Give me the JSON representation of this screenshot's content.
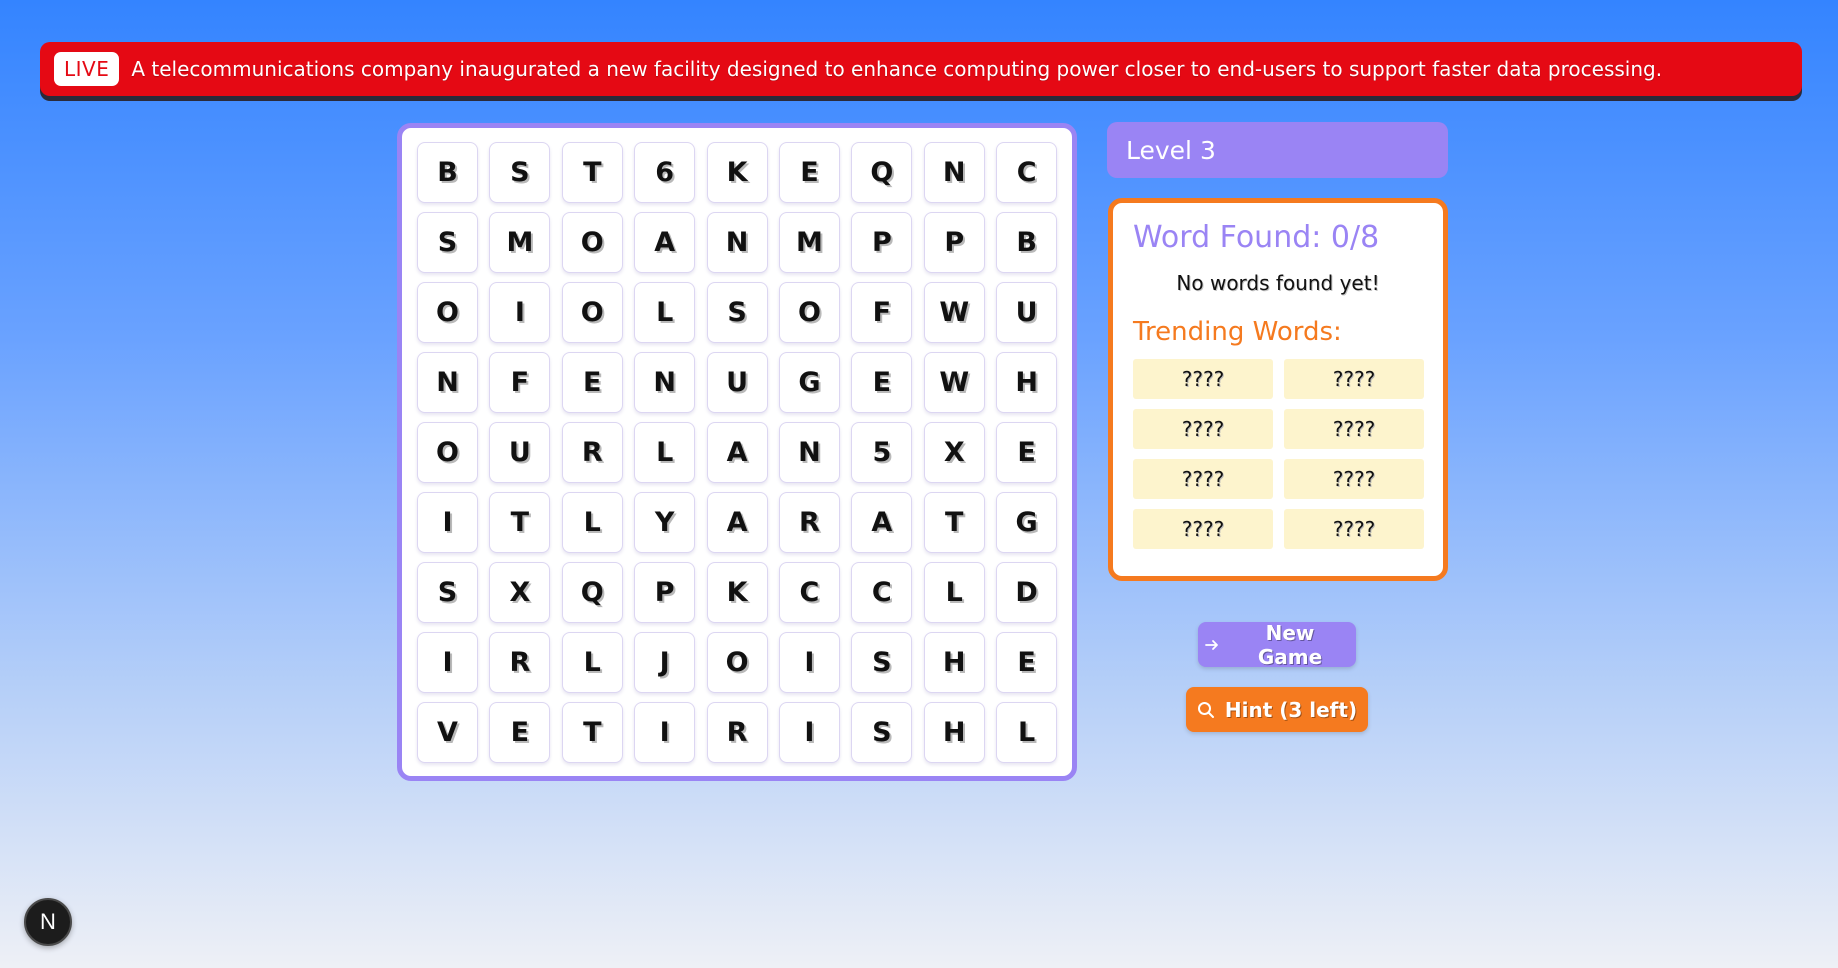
{
  "ticker": {
    "badge": "LIVE",
    "text": "A telecommunications company inaugurated a new facility designed to enhance computing power closer to end-users to support faster data processing."
  },
  "grid": {
    "rows": [
      [
        "B",
        "S",
        "T",
        "6",
        "K",
        "E",
        "Q",
        "N",
        "C"
      ],
      [
        "S",
        "M",
        "O",
        "A",
        "N",
        "M",
        "P",
        "P",
        "B"
      ],
      [
        "O",
        "I",
        "O",
        "L",
        "S",
        "O",
        "F",
        "W",
        "U"
      ],
      [
        "N",
        "F",
        "E",
        "N",
        "U",
        "G",
        "E",
        "W",
        "H"
      ],
      [
        "O",
        "U",
        "R",
        "L",
        "A",
        "N",
        "5",
        "X",
        "E"
      ],
      [
        "I",
        "T",
        "L",
        "Y",
        "A",
        "R",
        "A",
        "T",
        "G"
      ],
      [
        "S",
        "X",
        "Q",
        "P",
        "K",
        "C",
        "C",
        "L",
        "D"
      ],
      [
        "I",
        "R",
        "L",
        "J",
        "O",
        "I",
        "S",
        "H",
        "E"
      ],
      [
        "V",
        "E",
        "T",
        "I",
        "R",
        "I",
        "S",
        "H",
        "L"
      ]
    ]
  },
  "level": {
    "label": "Level 3"
  },
  "panel": {
    "found_title": "Word Found: 0/8",
    "empty_message": "No words found yet!",
    "trending_title": "Trending Words:",
    "words": [
      "????",
      "????",
      "????",
      "????",
      "????",
      "????",
      "????",
      "????"
    ]
  },
  "buttons": {
    "new_game": "New Game",
    "hint": "Hint (3 left)"
  },
  "n_badge": {
    "label": "N"
  },
  "colors": {
    "accent_purple": "#9a84f4",
    "accent_orange": "#f57a1f",
    "live_red": "#e50914",
    "word_slot": "#fdf4cd"
  },
  "icons": {
    "new_game": "arrow-right-icon",
    "hint": "search-icon"
  }
}
